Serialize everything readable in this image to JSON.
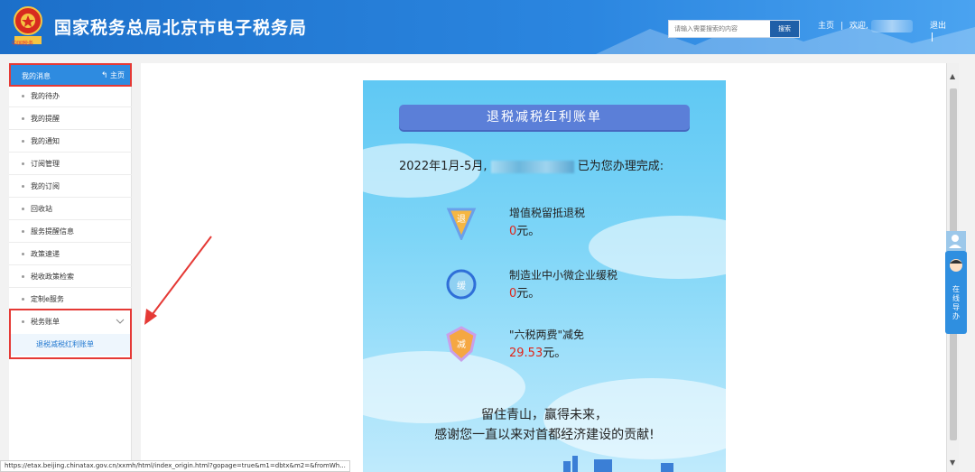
{
  "header": {
    "site_title": "国家税务总局北京市电子税务局",
    "logo_text": "中国税务",
    "search_placeholder": "请输入需要搜索的内容",
    "search_button": "搜索",
    "home_link": "主页",
    "welcome": "欢迎,",
    "logout": "退出"
  },
  "sidebar": {
    "header_label": "我的消息",
    "header_home": "主页",
    "items": [
      {
        "label": "我的待办"
      },
      {
        "label": "我的提醒"
      },
      {
        "label": "我的通知"
      },
      {
        "label": "订阅管理"
      },
      {
        "label": "我的订阅"
      },
      {
        "label": "回收站"
      },
      {
        "label": "服务提醒信息"
      },
      {
        "label": "政策速递"
      },
      {
        "label": "税收政策检索"
      },
      {
        "label": "定制e服务"
      },
      {
        "label": "税务账单"
      }
    ],
    "sub_item": "退税减税红利账单"
  },
  "poster": {
    "title": "退税减税红利账单",
    "intro_prefix": "2022年1月-5月,",
    "intro_suffix": "已为您办理完成:",
    "benefits": [
      {
        "badge": "退",
        "name": "增值税留抵退税",
        "amount": "0",
        "unit": "元。"
      },
      {
        "badge": "缓",
        "name": "制造业中小微企业缓税",
        "amount": "0",
        "unit": "元。"
      },
      {
        "badge": "减",
        "name": "\"六税两费\"减免",
        "amount": "29.53",
        "unit": "元。"
      }
    ],
    "thanks_line1": "留住青山，赢得未来，",
    "thanks_line2": "感谢您一直以来对首都经济建设的贡献!"
  },
  "float_service": {
    "label": "在线导办"
  },
  "status_bar": {
    "url": "https://etax.beijing.chinatax.gov.cn/xxmh/html/index_origin.html?gopage=true&m1=dbtx&m2=&fromWh..."
  },
  "colors": {
    "header_blue": "#2b86e0",
    "sidebar_header": "#2e8be0",
    "highlight_red": "#e53935",
    "amount_red": "#e0261a",
    "poster_sky": "#7dd5f7",
    "title_bar": "#5b7fd8"
  }
}
